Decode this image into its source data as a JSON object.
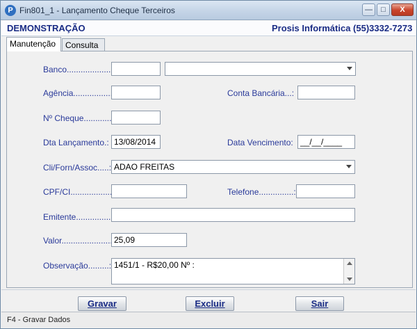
{
  "window": {
    "title": "Fin801_1 - Lançamento Cheque Terceiros",
    "icon": "p-app-icon",
    "controls": {
      "minimize": "—",
      "maximize": "□",
      "close": "X"
    }
  },
  "header": {
    "company": "DEMONSTRAÇÃO",
    "vendor": "Prosis Informática (55)3332-7273"
  },
  "tabs": [
    {
      "label": "Manutenção",
      "active": true
    },
    {
      "label": "Consulta",
      "active": false
    }
  ],
  "form": {
    "banco": {
      "label": "Banco.......................:",
      "code": "",
      "name": ""
    },
    "agencia": {
      "label": "Agência.................:",
      "value": ""
    },
    "conta": {
      "label": "Conta Bancária...:",
      "value": ""
    },
    "cheque": {
      "label": "Nº Cheque............:",
      "value": ""
    },
    "dta_lancamento": {
      "label": "Dta Lançamento.:",
      "value": "13/08/2014"
    },
    "data_vencimento": {
      "label": "Data Vencimento:",
      "value": "__/__/____"
    },
    "cliente": {
      "label": "Cli/Forn/Assoc.....:",
      "value": "ADAO FREITAS"
    },
    "cpf": {
      "label": "CPF/CI.....................:",
      "value": ""
    },
    "telefone": {
      "label": "Telefone...............:",
      "value": ""
    },
    "emitente": {
      "label": "Emitente.................:",
      "value": ""
    },
    "valor": {
      "label": "Valor........................:",
      "value": "25,09"
    },
    "observacao": {
      "label": "Observação.........:",
      "value": "1451/1 - R$20,00 Nº :"
    }
  },
  "buttons": {
    "gravar": "Gravar",
    "excluir": "Excluir",
    "sair": "Sair"
  },
  "status": {
    "text": "F4 - Gravar Dados"
  }
}
